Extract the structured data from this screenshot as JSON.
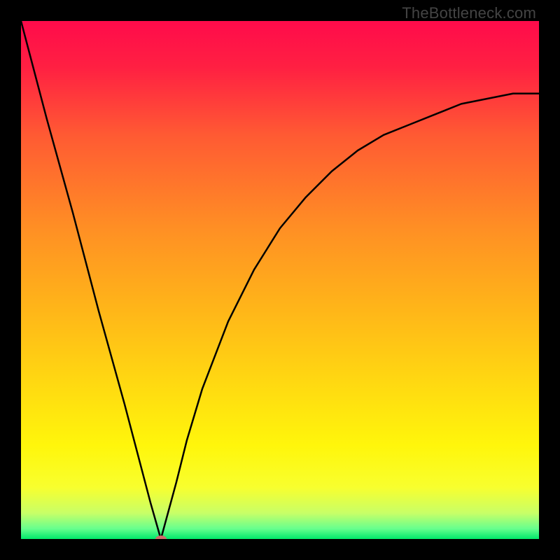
{
  "watermark": "TheBottleneck.com",
  "chart_data": {
    "type": "line",
    "title": "",
    "xlabel": "",
    "ylabel": "",
    "xlim": [
      0,
      100
    ],
    "ylim": [
      0,
      100
    ],
    "grid": false,
    "legend": false,
    "series": [
      {
        "name": "bottleneck-curve",
        "x": [
          0,
          5,
          10,
          15,
          20,
          25,
          27,
          30,
          32,
          35,
          40,
          45,
          50,
          55,
          60,
          65,
          70,
          75,
          80,
          85,
          90,
          95,
          100
        ],
        "values": [
          100,
          81,
          63,
          44,
          26,
          7,
          0,
          11,
          19,
          29,
          42,
          52,
          60,
          66,
          71,
          75,
          78,
          80,
          82,
          84,
          85,
          86,
          86
        ]
      }
    ],
    "annotations": [
      {
        "name": "minimum-marker",
        "x": 27,
        "y": 0
      }
    ],
    "background_gradient": {
      "stops": [
        {
          "offset": 0.0,
          "color": "#ff0b4b"
        },
        {
          "offset": 0.09,
          "color": "#ff2042"
        },
        {
          "offset": 0.22,
          "color": "#ff5a33"
        },
        {
          "offset": 0.4,
          "color": "#ff8f24"
        },
        {
          "offset": 0.55,
          "color": "#ffb419"
        },
        {
          "offset": 0.7,
          "color": "#ffd911"
        },
        {
          "offset": 0.82,
          "color": "#fff60b"
        },
        {
          "offset": 0.9,
          "color": "#f8ff2e"
        },
        {
          "offset": 0.95,
          "color": "#c8ff67"
        },
        {
          "offset": 0.98,
          "color": "#67ff8e"
        },
        {
          "offset": 1.0,
          "color": "#00e86a"
        }
      ]
    }
  },
  "icons": {
    "minimum_marker_color": "#cf6b6b"
  }
}
